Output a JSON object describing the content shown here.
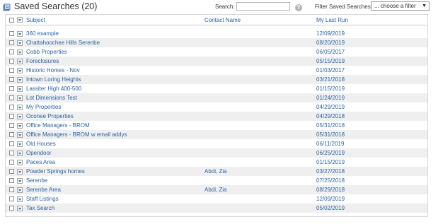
{
  "header": {
    "title": "Saved Searches (20)",
    "search_label": "Search:",
    "search_value": "",
    "filter_label": "Filter Saved Searches:",
    "filter_selected": "... choose a filter",
    "help_symbol": "?"
  },
  "columns": {
    "subject": "Subject",
    "contact": "Contact Name",
    "last_run": "My Last Run"
  },
  "rows": [
    {
      "subject": "360 example",
      "contact": "",
      "last_run": "12/09/2019"
    },
    {
      "subject": "Chattahoochee Hills Serenbe",
      "contact": "",
      "last_run": "08/20/2019"
    },
    {
      "subject": "Cobb Properties",
      "contact": "",
      "last_run": "06/05/2017"
    },
    {
      "subject": "Foreclosures",
      "contact": "",
      "last_run": "05/15/2019"
    },
    {
      "subject": "Historic Homes - Nov",
      "contact": "",
      "last_run": "01/03/2017"
    },
    {
      "subject": "Intown Loring Heights",
      "contact": "",
      "last_run": "03/21/2018"
    },
    {
      "subject": "Lassiter High 400-500",
      "contact": "",
      "last_run": "01/15/2019"
    },
    {
      "subject": "Lot Dimensions Test",
      "contact": "",
      "last_run": "01/24/2019"
    },
    {
      "subject": "My Properties",
      "contact": "",
      "last_run": "04/29/2019"
    },
    {
      "subject": "Oconee Properties",
      "contact": "",
      "last_run": "04/29/2018"
    },
    {
      "subject": "Office Managers - BROM",
      "contact": "",
      "last_run": "05/31/2018"
    },
    {
      "subject": "Office Managers - BROM w email addys",
      "contact": "",
      "last_run": "05/31/2018"
    },
    {
      "subject": "Old Houses",
      "contact": "",
      "last_run": "06/11/2019"
    },
    {
      "subject": "Opendoor",
      "contact": "",
      "last_run": "06/25/2019"
    },
    {
      "subject": "Paces Area",
      "contact": "",
      "last_run": "01/15/2019"
    },
    {
      "subject": "Powder Springs homes",
      "contact": "Abdi, Zia",
      "last_run": "03/27/2018"
    },
    {
      "subject": "Serenbe",
      "contact": "",
      "last_run": "07/25/2018"
    },
    {
      "subject": "Serenbe Area",
      "contact": "Abdi, Zia",
      "last_run": "08/29/2018"
    },
    {
      "subject": "Staff Listings",
      "contact": "",
      "last_run": "12/09/2019"
    },
    {
      "subject": "Tax Search",
      "contact": "",
      "last_run": "05/02/2019"
    }
  ]
}
